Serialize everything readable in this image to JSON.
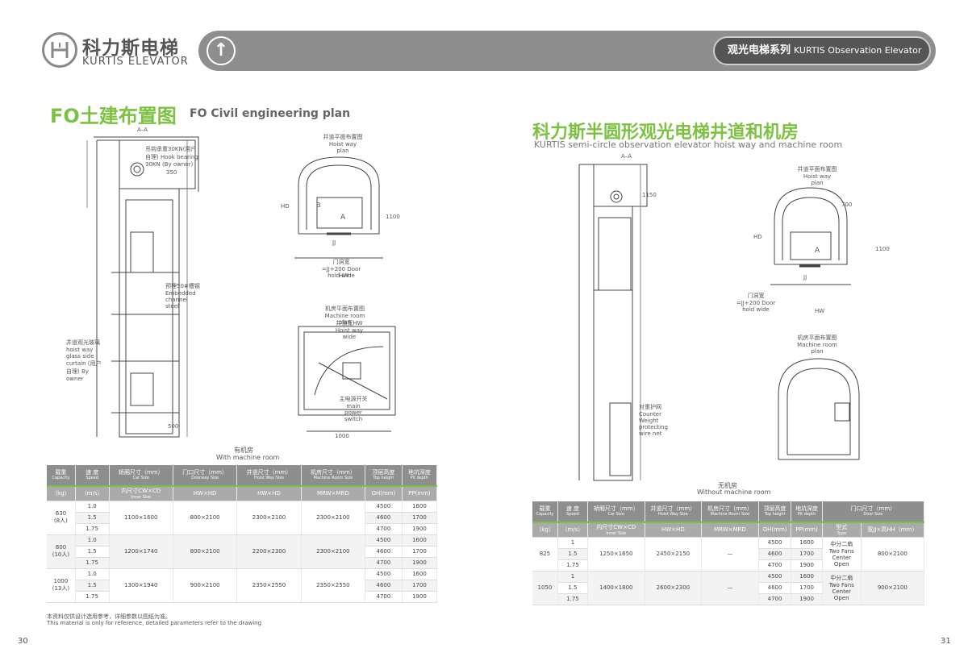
{
  "brand": {
    "cn": "科力斯电梯",
    "en": "KURTIS ELEVATOR"
  },
  "banner": {
    "series_cn": "观光电梯系列",
    "series_en": "KURTIS Observation Elevator",
    "arrow_icon": "arrow-up-icon"
  },
  "colors": {
    "accent": "#7cc142",
    "banner": "#8e8e8e"
  },
  "left": {
    "title_cn": "FO土建布置图",
    "title_en": "FO Civil engineering plan",
    "caption_cn": "有机房",
    "caption_en": "With machine room",
    "table": {
      "headers": [
        {
          "cn": "载重",
          "en": "Capacity"
        },
        {
          "cn": "速 度",
          "en": "Speed"
        },
        {
          "cn": "轿厢尺寸（mm）",
          "en": "Car Size"
        },
        {
          "cn": "门口尺寸（mm）",
          "en": "Doorway Size"
        },
        {
          "cn": "井道尺寸（mm）",
          "en": "Hoist Way Size"
        },
        {
          "cn": "机房尺寸（mm）",
          "en": "Machine Room Size"
        },
        {
          "cn": "顶层高度",
          "en": "Top height"
        },
        {
          "cn": "地坑深度",
          "en": "Pit depth"
        }
      ],
      "units": [
        {
          "cn": "（kg）",
          "en": ""
        },
        {
          "cn": "（m/s）",
          "en": ""
        },
        {
          "cn": "内尺寸CW×CD",
          "en": "Inner Size"
        },
        {
          "cn": "HW×HD",
          "en": ""
        },
        {
          "cn": "HW×HD",
          "en": ""
        },
        {
          "cn": "MRW×MRD",
          "en": ""
        },
        {
          "cn": "OH(mm)",
          "en": ""
        },
        {
          "cn": "PP(mm)",
          "en": ""
        }
      ],
      "groups": [
        {
          "capacity": "630",
          "persons": "(8人)",
          "car": "1100×1600",
          "door": "800×2100",
          "hoist": "2300×2100",
          "machine": "2300×2100",
          "rows": [
            {
              "speed": "1.0",
              "oh": "4500",
              "pp": "1600"
            },
            {
              "speed": "1.5",
              "oh": "4600",
              "pp": "1700"
            },
            {
              "speed": "1.75",
              "oh": "4700",
              "pp": "1900"
            }
          ]
        },
        {
          "capacity": "800",
          "persons": "(10人)",
          "car": "1200×1740",
          "door": "800×2100",
          "hoist": "2200×2300",
          "machine": "2300×2100",
          "rows": [
            {
              "speed": "1.0",
              "oh": "4500",
              "pp": "1600"
            },
            {
              "speed": "1.5",
              "oh": "4600",
              "pp": "1700"
            },
            {
              "speed": "1.75",
              "oh": "4700",
              "pp": "1900"
            }
          ]
        },
        {
          "capacity": "1000",
          "persons": "(13人)",
          "car": "1300×1940",
          "door": "900×2100",
          "hoist": "2350×2550",
          "machine": "2350×2550",
          "rows": [
            {
              "speed": "1.0",
              "oh": "4500",
              "pp": "1600"
            },
            {
              "speed": "1.5",
              "oh": "4600",
              "pp": "1700"
            },
            {
              "speed": "1.75",
              "oh": "4700",
              "pp": "1900"
            }
          ]
        }
      ]
    },
    "note_cn": "本资料仅供设计选用参考，详细参数以图纸为准。",
    "note_en": "This material is only for reference, detailed parameters refer to the drawing",
    "page_number": "30"
  },
  "right": {
    "title_cn": "科力斯半圆形观光电梯井道和机房",
    "title_en": "KURTIS semi-circle observation elevator hoist way and machine room",
    "caption_cn": "无机房",
    "caption_en": "Without machine room",
    "table": {
      "headers": [
        {
          "cn": "载重",
          "en": "Capacity"
        },
        {
          "cn": "速 度",
          "en": "Speed"
        },
        {
          "cn": "轿厢尺寸（mm）",
          "en": "Car Size"
        },
        {
          "cn": "井道尺寸（mm）",
          "en": "Hoist Way Size"
        },
        {
          "cn": "机房尺寸（mm）",
          "en": "Machine Room Size"
        },
        {
          "cn": "顶层高度",
          "en": "Top height"
        },
        {
          "cn": "地坑深度",
          "en": "Pit depth"
        },
        {
          "cn": "门口尺寸（mm）",
          "en": "Door Size"
        }
      ],
      "units": [
        {
          "cn": "（kg）",
          "en": ""
        },
        {
          "cn": "（m/s）",
          "en": ""
        },
        {
          "cn": "内尺寸CW×CD",
          "en": "Inner Size"
        },
        {
          "cn": "HW×HD",
          "en": ""
        },
        {
          "cn": "MRW×MRD",
          "en": ""
        },
        {
          "cn": "OH(mm)",
          "en": ""
        },
        {
          "cn": "PP(mm)",
          "en": ""
        },
        {
          "cn": "型式",
          "en": "Type"
        },
        {
          "cn": "宽JJ×高HH（mm）",
          "en": ""
        }
      ],
      "groups": [
        {
          "capacity": "825",
          "car": "1250×1650",
          "hoist": "2450×2150",
          "machine": "—",
          "type": "中分二扇 Two Fans Center Open",
          "door": "800×2100",
          "rows": [
            {
              "speed": "1",
              "oh": "4500",
              "pp": "1600"
            },
            {
              "speed": "1.5",
              "oh": "4600",
              "pp": "1700"
            },
            {
              "speed": "1.75",
              "oh": "4700",
              "pp": "1900"
            }
          ]
        },
        {
          "capacity": "1050",
          "car": "1400×1800",
          "hoist": "2600×2300",
          "machine": "—",
          "type": "中分二扇 Two Fans Center Open",
          "door": "900×2100",
          "rows": [
            {
              "speed": "1",
              "oh": "4500",
              "pp": "1600"
            },
            {
              "speed": "1.5",
              "oh": "4600",
              "pp": "1700"
            },
            {
              "speed": "1.75",
              "oh": "4700",
              "pp": "1900"
            }
          ]
        }
      ]
    },
    "page_number": "31"
  },
  "drawing_labels": {
    "section_aa": "A–A",
    "hook": "吊钩承重30KN(用户自理) Hook bearing 30KN (By owner)",
    "hoist_plan": "井道平面布置图 Hoist way plan",
    "machine_plan": "机房平面布置图 Machine room plan",
    "hd": "HD",
    "hw": "HW",
    "a": "A",
    "b": "B",
    "jj": "JJ",
    "door_hold": "门洞宽=JJ+200 Door hold wide",
    "dim_500": "500",
    "dim_1100": "1100",
    "dim_350": "350",
    "dim_1000": "1000",
    "dim_700": "700",
    "dim_1150": "1150",
    "embedded": "预埋50#槽钢 Embedded channel steel",
    "glass": "井道观光玻璃 hoist way glass side curtain (用户自理) By owner",
    "counter_weight": "对重护网 Counter Weight protecting wire net",
    "main_switch": "主电源开关 main power switch",
    "hoistway_wide": "井道宽HW Hoist way wide"
  }
}
